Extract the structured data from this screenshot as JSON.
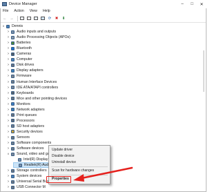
{
  "window": {
    "title": "Device Manager",
    "controls": {
      "minimize": "–",
      "maximize": "□",
      "close": "✕"
    }
  },
  "menu": [
    "File",
    "Action",
    "View",
    "Help"
  ],
  "toolbar": {
    "back_glyph": "←",
    "forward_glyph": "→",
    "scan_glyph": "⟳",
    "remove_glyph": "✖",
    "download_glyph": "⬇"
  },
  "tree": {
    "root": {
      "label": "Dennis",
      "expander": "∨",
      "icon": "computer-icon"
    },
    "categories": [
      {
        "label": "Audio inputs and outputs",
        "expander": ">",
        "icon": "speaker-icon",
        "color": "#7a8fa8"
      },
      {
        "label": "Audio Processing Objects (APOs)",
        "expander": ">",
        "icon": "audio-chip-icon",
        "color": "#8b98a8"
      },
      {
        "label": "Batteries",
        "expander": ">",
        "icon": "battery-icon",
        "color": "#4f8a3c"
      },
      {
        "label": "Bluetooth",
        "expander": ">",
        "icon": "bluetooth-icon",
        "color": "#1f6fcf"
      },
      {
        "label": "Cameras",
        "expander": ">",
        "icon": "camera-icon",
        "color": "#555d66"
      },
      {
        "label": "Computer",
        "expander": ">",
        "icon": "computer-icon",
        "color": "#4a80b8"
      },
      {
        "label": "Disk drives",
        "expander": ">",
        "icon": "disk-icon",
        "color": "#6b7380"
      },
      {
        "label": "Display adapters",
        "expander": ">",
        "icon": "display-adapter-icon",
        "color": "#3c7fb8"
      },
      {
        "label": "Firmware",
        "expander": ">",
        "icon": "firmware-icon",
        "color": "#7d8590"
      },
      {
        "label": "Human Interface Devices",
        "expander": ">",
        "icon": "hid-icon",
        "color": "#6f7a86"
      },
      {
        "label": "IDE ATA/ATAPI controllers",
        "expander": ">",
        "icon": "ide-controller-icon",
        "color": "#7a8696"
      },
      {
        "label": "Keyboards",
        "expander": ">",
        "icon": "keyboard-icon",
        "color": "#596470"
      },
      {
        "label": "Mice and other pointing devices",
        "expander": ">",
        "icon": "mouse-icon",
        "color": "#6a7480"
      },
      {
        "label": "Monitors",
        "expander": ">",
        "icon": "monitor-icon",
        "color": "#3f7cc0"
      },
      {
        "label": "Network adapters",
        "expander": ">",
        "icon": "network-icon",
        "color": "#3b7ab5"
      },
      {
        "label": "Print queues",
        "expander": ">",
        "icon": "printer-icon",
        "color": "#6c737c"
      },
      {
        "label": "Processors",
        "expander": ">",
        "icon": "processor-icon",
        "color": "#5d6b7b"
      },
      {
        "label": "SD host adapters",
        "expander": ">",
        "icon": "sd-card-icon",
        "color": "#6e7a88"
      },
      {
        "label": "Security devices",
        "expander": ">",
        "icon": "security-icon",
        "color": "#c8a23a"
      },
      {
        "label": "Sensors",
        "expander": ">",
        "icon": "sensor-icon",
        "color": "#6b7784"
      },
      {
        "label": "Software components",
        "expander": ">",
        "icon": "software-component-icon",
        "color": "#6f7d8c"
      },
      {
        "label": "Software devices",
        "expander": ">",
        "icon": "software-device-icon",
        "color": "#6f7d8c"
      },
      {
        "label": "Sound, video and game controllers",
        "expander": "∨",
        "icon": "sound-controller-icon",
        "color": "#7a8798"
      }
    ],
    "children": [
      {
        "label": "Intel(R) Display Audio",
        "icon": "speaker-icon",
        "color": "#7a8fa8"
      },
      {
        "label": "Realtek(R) Audio",
        "icon": "speaker-icon",
        "color": "#7a8fa8"
      }
    ],
    "categories_after": [
      {
        "label": "Storage controllers",
        "expander": ">",
        "icon": "storage-icon",
        "color": "#6c7785"
      },
      {
        "label": "System devices",
        "expander": ">",
        "icon": "system-device-icon",
        "color": "#4a80b8"
      },
      {
        "label": "Universal Serial Bus",
        "expander": ">",
        "icon": "usb-icon",
        "color": "#6c7785"
      },
      {
        "label": "USB Connector M",
        "expander": ">",
        "icon": "usb-connector-icon",
        "color": "#6c7785"
      }
    ]
  },
  "context_menu": {
    "items": [
      "Update driver",
      "Disable device",
      "Uninstall device",
      "Scan for hardware changes",
      "Properties"
    ]
  },
  "annotation_colors": {
    "highlight": "#e5211d",
    "arrow": "#e5211d"
  }
}
